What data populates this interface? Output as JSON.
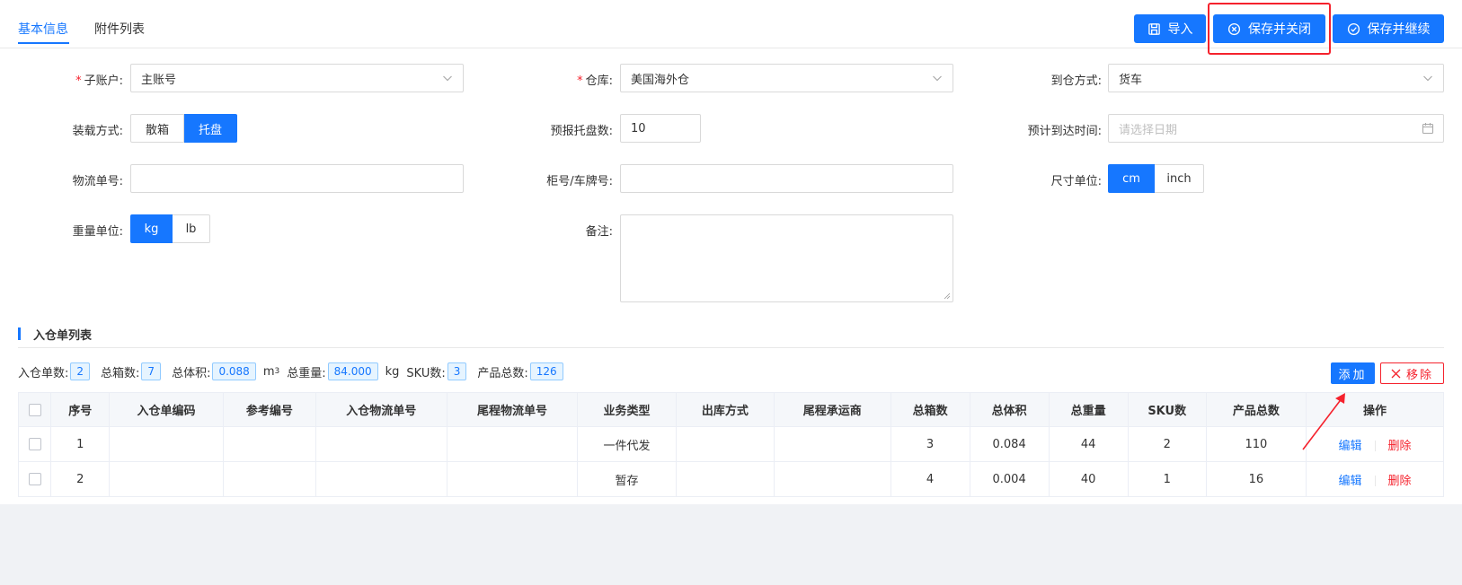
{
  "tabs": [
    {
      "label": "基本信息",
      "active": true
    },
    {
      "label": "附件列表",
      "active": false
    }
  ],
  "actions": {
    "import": "导入",
    "save_close": "保存并关闭",
    "save_continue": "保存并继续"
  },
  "form": {
    "sub_account": {
      "label": "子账户:",
      "required": true,
      "value": "主账号"
    },
    "warehouse": {
      "label": "仓库:",
      "required": true,
      "value": "美国海外仓"
    },
    "arrival_method": {
      "label": "到仓方式:",
      "value": "货车"
    },
    "loading_method": {
      "label": "装载方式:",
      "options": [
        "散箱",
        "托盘"
      ],
      "selected": "托盘"
    },
    "pallet_count": {
      "label": "预报托盘数:",
      "value": "10"
    },
    "eta": {
      "label": "预计到达时间:",
      "placeholder": "请选择日期"
    },
    "tracking_no": {
      "label": "物流单号:",
      "value": ""
    },
    "container_no": {
      "label": "柜号/车牌号:",
      "value": ""
    },
    "size_unit": {
      "label": "尺寸单位:",
      "options": [
        "cm",
        "inch"
      ],
      "selected": "cm"
    },
    "weight_unit": {
      "label": "重量单位:",
      "options": [
        "kg",
        "lb"
      ],
      "selected": "kg"
    },
    "remark": {
      "label": "备注:",
      "value": ""
    }
  },
  "section": {
    "title": "入仓单列表"
  },
  "summary": {
    "order_count_label": "入仓单数:",
    "order_count": "2",
    "box_total_label": "总箱数:",
    "box_total": "7",
    "volume_label": "总体积:",
    "volume": "0.088",
    "volume_unit": "m",
    "volume_unit_sup": "3",
    "weight_label": "总重量:",
    "weight": "84.000",
    "weight_unit": "kg",
    "sku_label": "SKU数:",
    "sku": "3",
    "product_total_label": "产品总数:",
    "product_total": "126"
  },
  "table_actions": {
    "add": "添加",
    "remove": "移除"
  },
  "table": {
    "columns": [
      "序号",
      "入仓单编码",
      "参考编号",
      "入仓物流单号",
      "尾程物流单号",
      "业务类型",
      "出库方式",
      "尾程承运商",
      "总箱数",
      "总体积",
      "总重量",
      "SKU数",
      "产品总数",
      "操作"
    ],
    "rows": [
      {
        "index": "1",
        "code": "",
        "ref": "",
        "inbound_tracking": "",
        "last_mile_tracking": "",
        "biz_type": "一件代发",
        "outbound": "",
        "carrier": "",
        "boxes": "3",
        "volume": "0.084",
        "weight": "44",
        "sku": "2",
        "products": "110"
      },
      {
        "index": "2",
        "code": "",
        "ref": "",
        "inbound_tracking": "",
        "last_mile_tracking": "",
        "biz_type": "暂存",
        "outbound": "",
        "carrier": "",
        "boxes": "4",
        "volume": "0.004",
        "weight": "40",
        "sku": "1",
        "products": "16"
      }
    ],
    "op_edit": "编辑",
    "op_delete": "删除"
  },
  "colors": {
    "primary": "#1677ff",
    "danger": "#f5222d"
  }
}
